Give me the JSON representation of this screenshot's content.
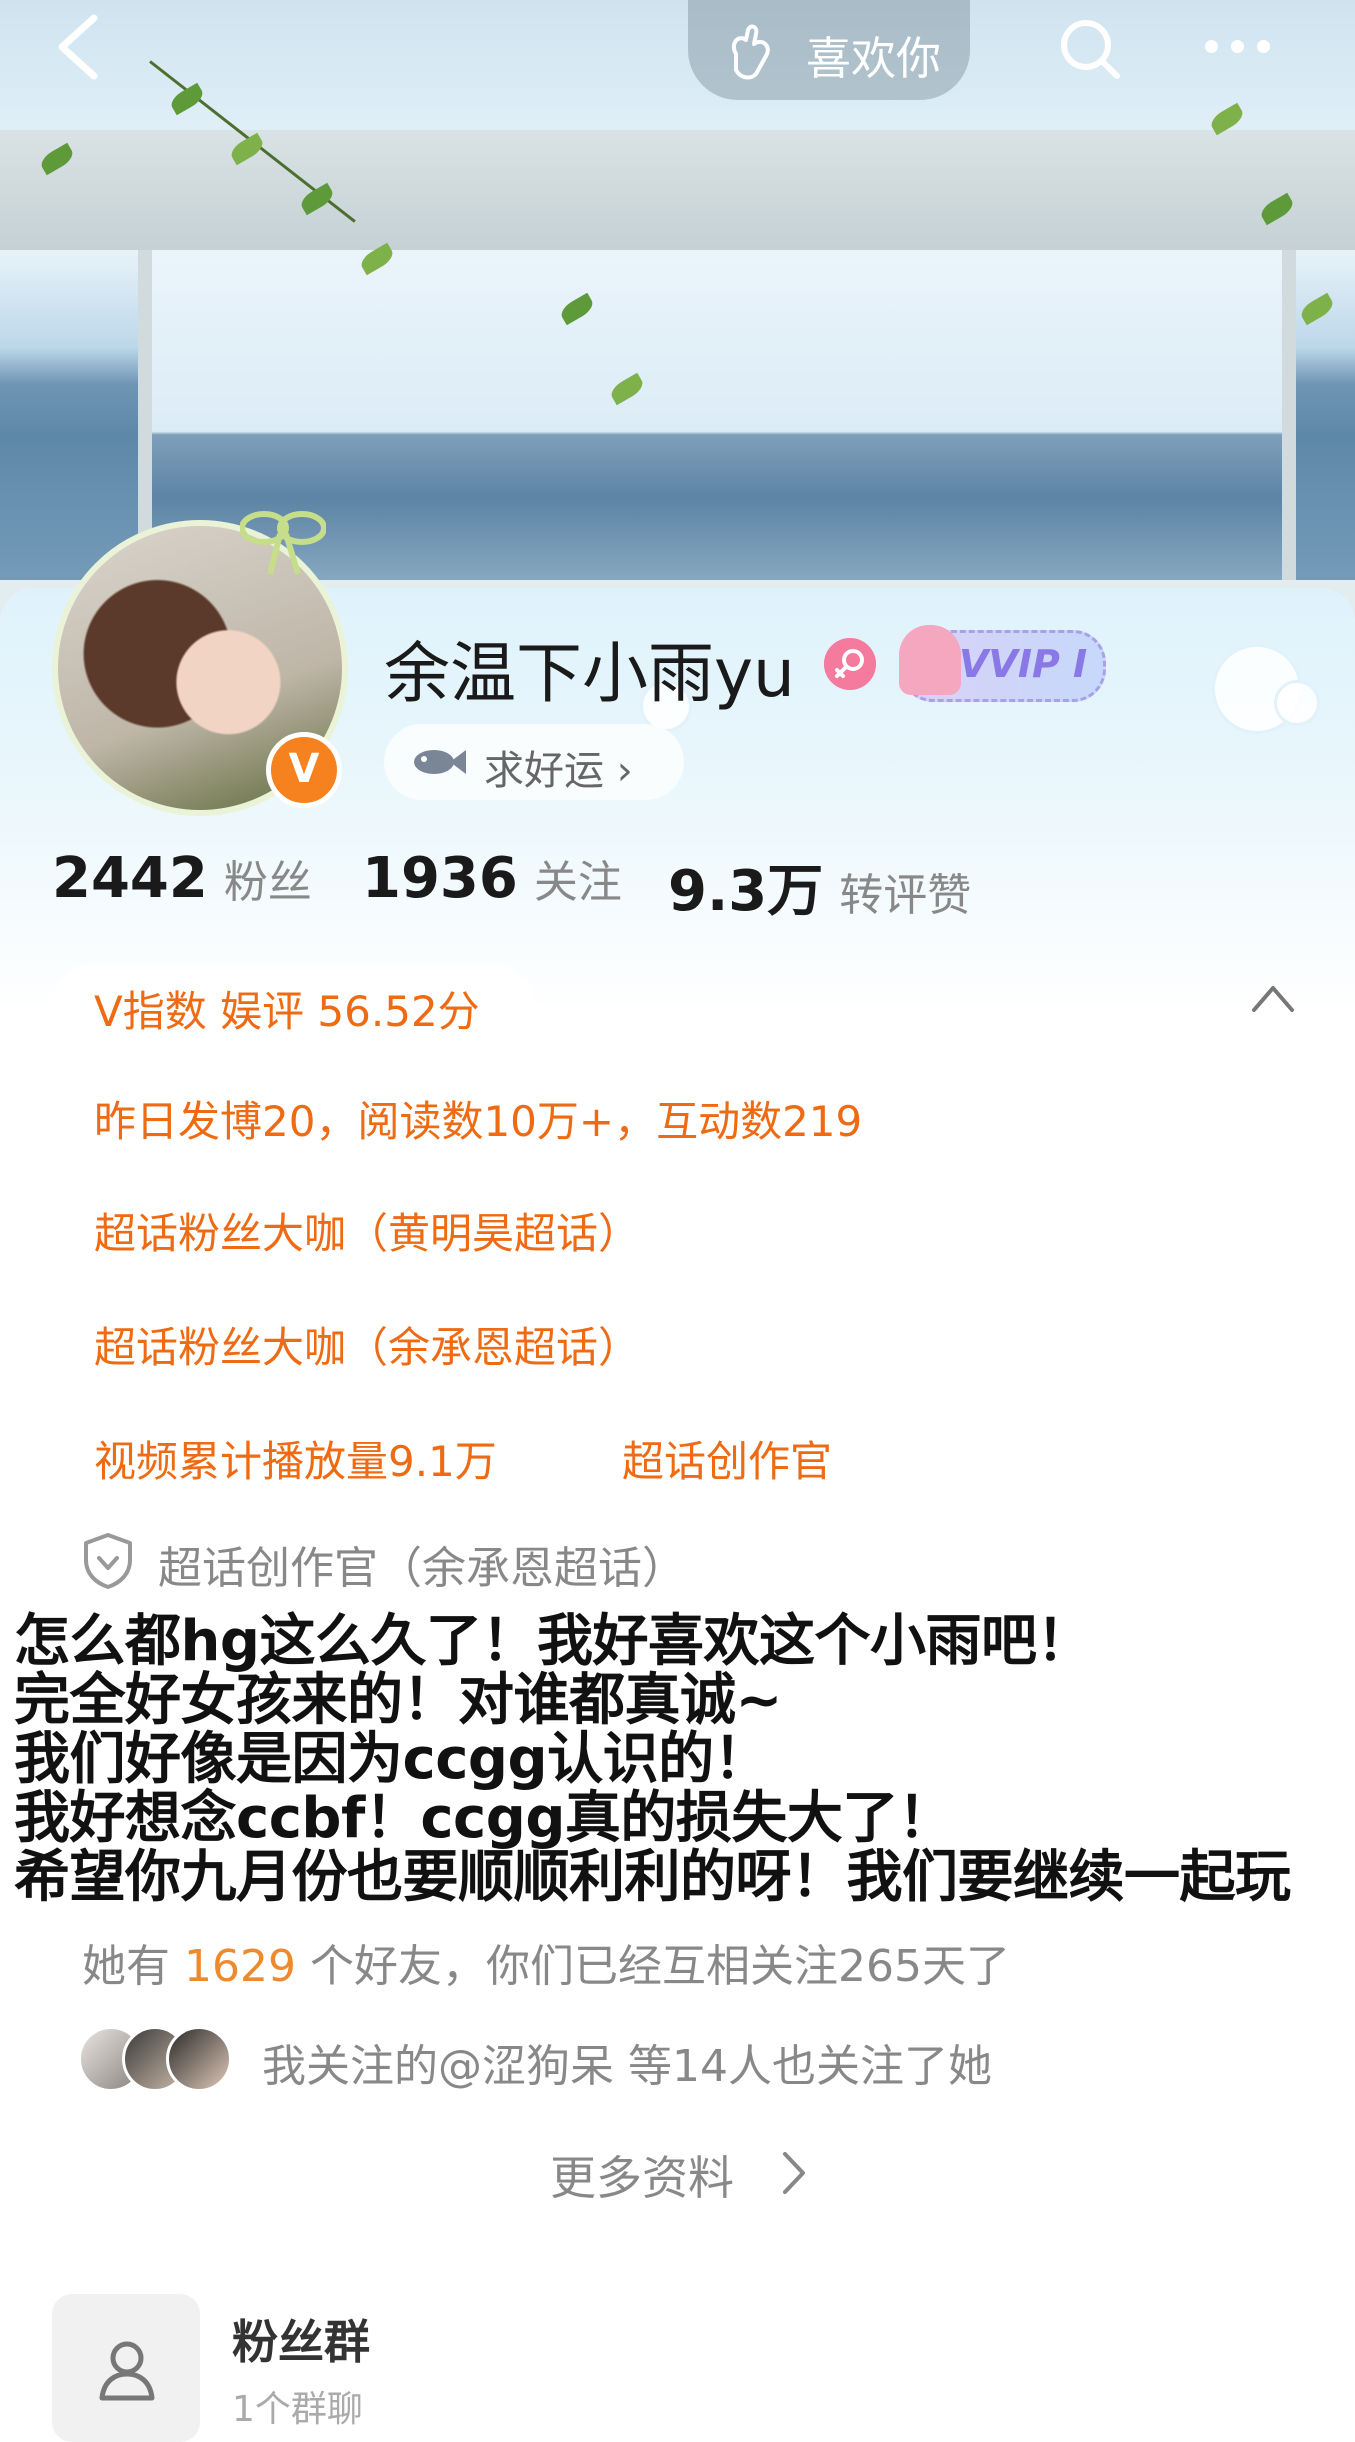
{
  "topbar": {
    "like_label": "喜欢你"
  },
  "profile": {
    "username": "余温下小雨yu",
    "verified_badge": "V",
    "vip_label": "VVIP I",
    "status_label": "求好运 ›"
  },
  "stats": [
    {
      "value": "2442",
      "label": "粉丝"
    },
    {
      "value": "1936",
      "label": "关注"
    },
    {
      "value": "9.3万",
      "label": "转评赞"
    }
  ],
  "vindex": {
    "label": "V指数 娱评 56.52分"
  },
  "honors": {
    "line1": "昨日发博20，阅读数10万+，互动数219",
    "line2": "超话粉丝大咖（黄明昊超话）",
    "line3": "超话粉丝大咖（余承恩超话）",
    "line4a": "视频累计播放量9.1万",
    "line4b": "超话创作官"
  },
  "creator_title": "超话创作官（余承恩超话）",
  "overlay_text": [
    "怎么都hg这么久了！我好喜欢这个小雨吧！",
    "完全好女孩来的！对谁都真诚~",
    "我们好像是因为ccgg认识的！",
    "我好想念ccbf！ccgg真的损失大了！",
    "希望你九月份也要顺顺利利的呀！我们要继续一起玩"
  ],
  "friends": {
    "prefix": "她有 ",
    "count": "1629",
    "suffix": " 个好友，你们已经互相关注265天了"
  },
  "mutual": {
    "text": "我关注的@涩狗呆 等14人也关注了她"
  },
  "more_info": "更多资料",
  "fan_group": {
    "title": "粉丝群",
    "subtitle": "1个群聊"
  },
  "colors": {
    "accent_orange": "#ee6b14",
    "verified_orange": "#f5821f",
    "female_pink": "#f47a9e",
    "muted_text": "#888888"
  },
  "icons": [
    "back-icon",
    "heart-hand-icon",
    "search-icon",
    "more-icon",
    "female-icon",
    "fish-icon",
    "chevron-up-icon",
    "shield-icon",
    "chevron-right-icon",
    "group-icon"
  ]
}
